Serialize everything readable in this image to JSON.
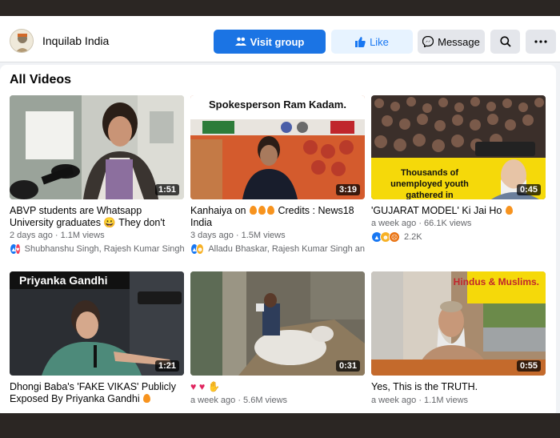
{
  "page": {
    "name": "Inquilab India"
  },
  "header": {
    "visit_group": "Visit group",
    "like": "Like",
    "message": "Message"
  },
  "section": {
    "title": "All Videos"
  },
  "videos": [
    {
      "duration": "1:51",
      "title": "ABVP students are Whatsapp University graduates 😀 They don't even trust...",
      "meta": "2 days ago · 1.1M views",
      "reactions": "Shubhanshu Singh, Rajesh Kumar Singh ..."
    },
    {
      "duration": "3:19",
      "title_pre": "Kanhaiya on ",
      "title_post": " Credits : News18 India",
      "meta": "3 days ago · 1.5M views",
      "reactions": "Alladu Bhaskar, Rajesh Kumar Singh and",
      "thumb_text": "Spokesperson Ram Kadam."
    },
    {
      "duration": "0:45",
      "title_pre": "'GUJARAT MODEL' Ki Jai Ho ",
      "meta": "a week ago · 66.1K views",
      "reactions": "2.2K",
      "thumb_text": "Thousands of unemployed youth gathered in"
    },
    {
      "duration": "1:21",
      "title_pre": "Dhongi Baba's 'FAKE VIKAS' Publicly Exposed By Priyanka Gandhi ",
      "meta": "",
      "reactions": "",
      "thumb_text": "Priyanka Gandhi"
    },
    {
      "duration": "0:31",
      "title": "",
      "meta": "a week ago · 5.6M views",
      "reactions": ""
    },
    {
      "duration": "0:55",
      "title": "Yes, This is the TRUTH.",
      "meta": "a week ago · 1.1M views",
      "reactions": "",
      "thumb_text": "Hindus & Muslims."
    }
  ],
  "colors": {
    "primary": "#1b74e4",
    "like_bg": "#e7f3ff",
    "text": "#050505",
    "muted": "#65676b"
  },
  "icons": [
    "people-icon",
    "thumbs-up-icon",
    "messenger-icon",
    "search-icon",
    "more-icon"
  ]
}
